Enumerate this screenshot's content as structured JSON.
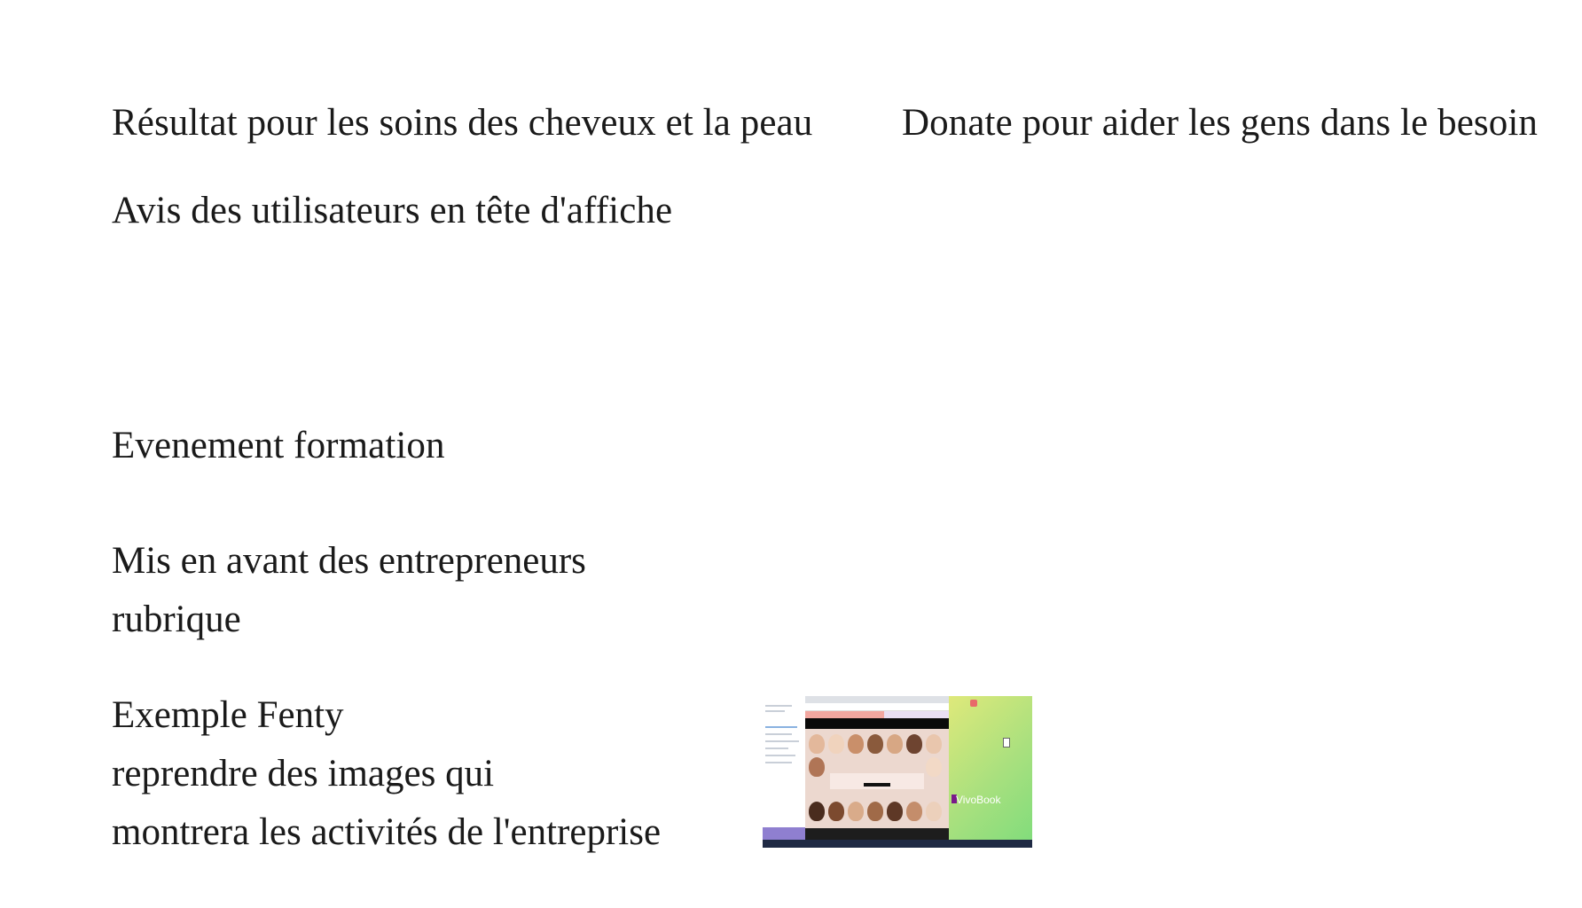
{
  "notes": {
    "line1_left": "Résultat pour les soins des cheveux et la peau",
    "line1_right": "Donate pour aider les gens dans le besoin",
    "line2": "Avis des utilisateurs en  tête d'affiche",
    "line3": "Evenement formation",
    "block1": [
      "Mis en avant des entrepreneurs",
      "rubrique"
    ],
    "block2": [
      "Exemple Fenty",
      "reprendre des images qui",
      "montrera les activités de l'entreprise"
    ]
  },
  "thumbnail": {
    "logo_text": "VivoBook",
    "colors": {
      "desktop_start": "#fbe38a",
      "desktop_end": "#7fdc7c",
      "nav_bar": "#0a0a0a",
      "hero_bg": "#ecd8cf"
    }
  }
}
